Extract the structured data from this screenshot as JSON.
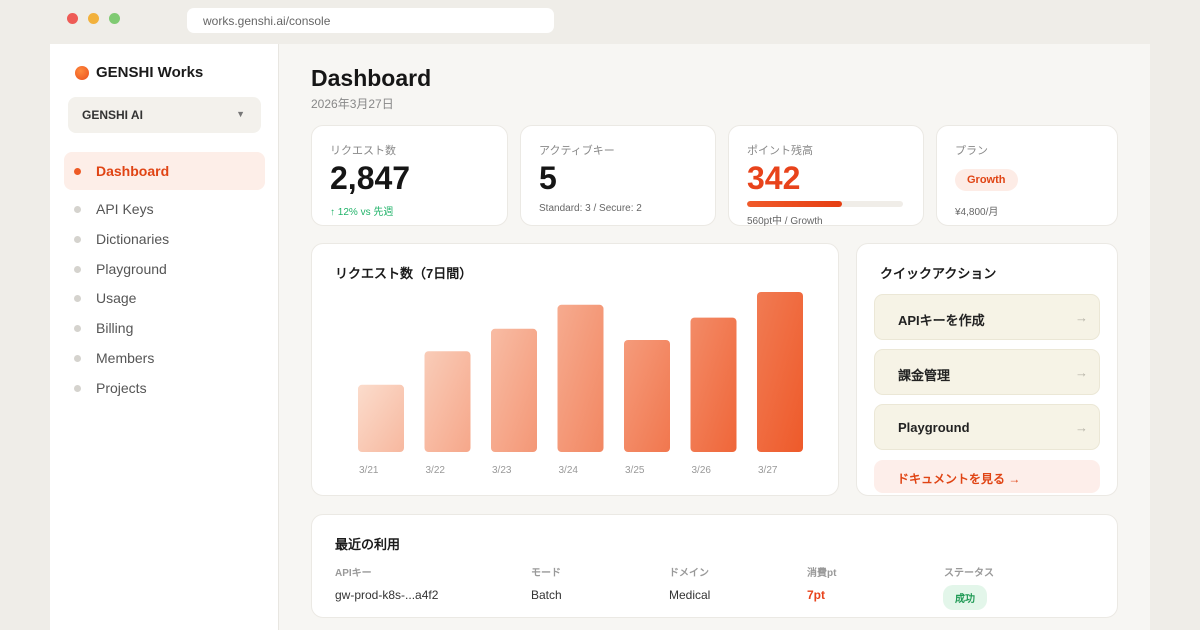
{
  "browser": {
    "url": "works.genshi.ai/console"
  },
  "sidebar": {
    "brand": "GENSHI Works",
    "org": "GENSHI AI",
    "items": [
      {
        "label": "Dashboard",
        "active": true
      },
      {
        "label": "API Keys"
      },
      {
        "label": "Dictionaries"
      },
      {
        "label": "Playground"
      },
      {
        "label": "Usage"
      },
      {
        "label": "Billing"
      },
      {
        "label": "Members"
      },
      {
        "label": "Projects"
      }
    ]
  },
  "header": {
    "title": "Dashboard",
    "date": "2026年3月27日"
  },
  "stats": {
    "requests": {
      "label": "リクエスト数",
      "value": "2,847",
      "sub": "↑ 12% vs 先週"
    },
    "keys": {
      "label": "アクティブキー",
      "value": "5",
      "sub": "Standard: 3 / Secure: 2"
    },
    "points": {
      "label": "ポイント残高",
      "value": "342",
      "progress": 0.61,
      "sub": "560pt中 / Growth"
    },
    "plan": {
      "label": "プラン",
      "badge": "Growth",
      "price": "¥4,800/月"
    }
  },
  "chart_card": {
    "title": "リクエスト数（7日間）"
  },
  "chart_data": {
    "type": "bar",
    "title": "リクエスト数（7日間）",
    "categories": [
      "3/21",
      "3/22",
      "3/23",
      "3/24",
      "3/25",
      "3/26",
      "3/27"
    ],
    "values": [
      0.42,
      0.63,
      0.77,
      0.92,
      0.7,
      0.84,
      1.0
    ],
    "xlabel": "",
    "ylabel": "",
    "grid": false
  },
  "quick_actions": {
    "title": "クイックアクション",
    "buttons": [
      "APIキーを作成",
      "課金管理",
      "Playground"
    ],
    "arrow": "→",
    "docs": "ドキュメントを見る →"
  },
  "recent": {
    "title": "最近の利用",
    "columns": [
      "APIキー",
      "モード",
      "ドメイン",
      "消費pt",
      "ステータス"
    ],
    "rows": [
      {
        "key": "gw-prod-k8s-...a4f2",
        "mode": "Batch",
        "domain": "Medical",
        "pt": "7pt",
        "status": "成功"
      }
    ]
  },
  "colors": {
    "accent": "#e8431b",
    "bar_light": "#fbdccc",
    "bar_dark": "#ee5a2a"
  }
}
